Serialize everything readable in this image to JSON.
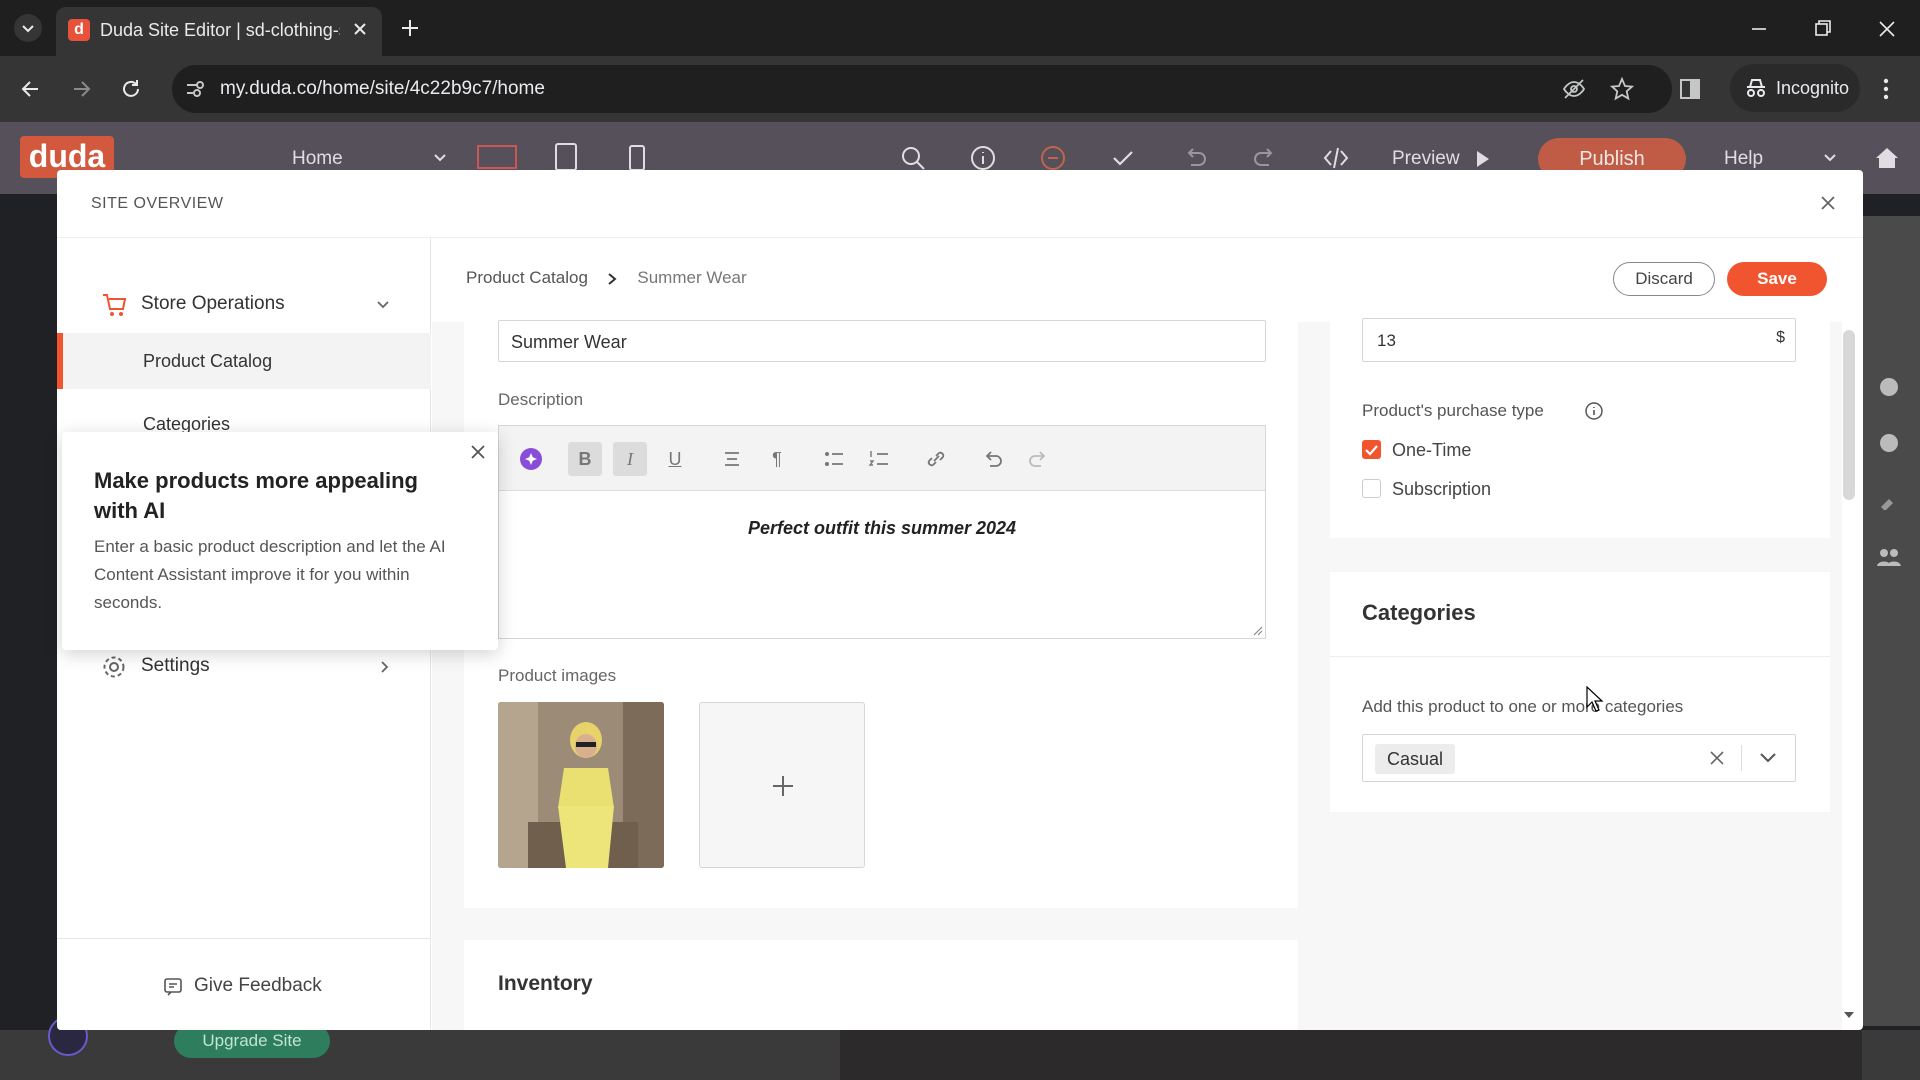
{
  "browser": {
    "tab_title": "Duda Site Editor | sd-clothing-s",
    "url": "my.duda.co/home/site/4c22b9c7/home",
    "incognito_label": "Incognito"
  },
  "editor_bar": {
    "logo": "duda",
    "page_select": "Home",
    "preview": "Preview",
    "publish": "Publish",
    "help": "Help"
  },
  "background": {
    "upgrade_button": "Upgrade Site"
  },
  "modal": {
    "title": "SITE OVERVIEW",
    "nav": {
      "store_operations": "Store Operations",
      "product_catalog": "Product Catalog",
      "categories": "Categories",
      "settings": "Settings",
      "feedback": "Give Feedback"
    },
    "ai_popover": {
      "heading": "Make products more appealing with AI",
      "body": "Enter a basic product description and let the AI Content Assistant improve it for you within seconds."
    },
    "breadcrumb": {
      "parent": "Product Catalog",
      "current": "Summer Wear"
    },
    "actions": {
      "discard": "Discard",
      "save": "Save"
    },
    "product": {
      "name_value": "Summer Wear",
      "description_label": "Description",
      "description_text": "Perfect outfit this summer 2024",
      "images_label": "Product images",
      "inventory_label": "Inventory"
    },
    "pricing": {
      "price_value": "13",
      "currency": "$",
      "purchase_type_label": "Product's purchase type",
      "options": [
        {
          "label": "One-Time",
          "checked": true
        },
        {
          "label": "Subscription",
          "checked": false
        }
      ]
    },
    "categories_card": {
      "title": "Categories",
      "hint": "Add this product to one or more categories",
      "selected": "Casual"
    }
  },
  "colors": {
    "accent": "#f0552f",
    "duda_bar": "#56505a"
  }
}
